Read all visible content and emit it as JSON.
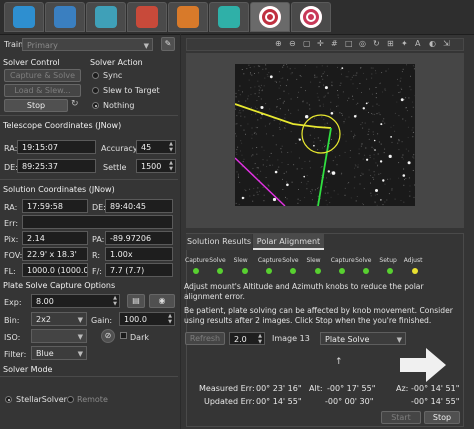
{
  "tabs": [
    {
      "name": "setup",
      "color": "#2e8fd0"
    },
    {
      "name": "capture",
      "color": "#3a7fc0"
    },
    {
      "name": "focus",
      "color": "#3fa0b8"
    },
    {
      "name": "camera",
      "color": "#c84a3a"
    },
    {
      "name": "analyze",
      "color": "#d87a2a"
    },
    {
      "name": "mount",
      "color": "#2fb0a8"
    },
    {
      "name": "target",
      "color": "#c03040",
      "active": true
    },
    {
      "name": "guide",
      "color": "#c83858"
    }
  ],
  "train": {
    "label": "Train:",
    "value": "Primary"
  },
  "solver_control": {
    "title": "Solver Control",
    "capture_solve": "Capture & Solve",
    "load_slew": "Load & Slew...",
    "stop": "Stop"
  },
  "solver_action": {
    "title": "Solver Action",
    "options": [
      {
        "label": "Sync",
        "selected": false
      },
      {
        "label": "Slew to Target",
        "selected": false
      },
      {
        "label": "Nothing",
        "selected": true
      }
    ]
  },
  "telescope": {
    "title": "Telescope Coordinates (JNow)",
    "ra_label": "RA:",
    "ra": "19:15:07",
    "de_label": "DE:",
    "de": "89:25:37",
    "accuracy_label": "Accuracy",
    "accuracy": "45",
    "settle_label": "Settle",
    "settle": "1500"
  },
  "solution": {
    "title": "Solution Coordinates (JNow)",
    "ra_label": "RA:",
    "ra": "17:59:58",
    "de_label": "DE:",
    "de": "89:40:45",
    "err_label": "Err:",
    "err": "",
    "pix_label": "Pix:",
    "pix": "2.14",
    "pa_label": "PA:",
    "pa": "-89.97206",
    "fov_label": "FOV:",
    "fov": "22.9' x 18.3'",
    "r_label": "R:",
    "r": "1.00x",
    "fl_label": "FL:",
    "fl": "1000.0 (1000.0)",
    "f_label": "F/:",
    "f": "7.7 (7.7)"
  },
  "capture": {
    "title": "Plate Solve Capture Options",
    "exp_label": "Exp:",
    "exp": "8.00",
    "bin_label": "Bin:",
    "bin": "2x2",
    "gain_label": "Gain:",
    "gain": "100.0",
    "iso_label": "ISO:",
    "iso": "",
    "dark_label": "Dark",
    "filter_label": "Filter:",
    "filter": "Blue"
  },
  "solver_mode": {
    "title": "Solver Mode",
    "options": [
      {
        "label": "StellarSolver",
        "selected": true
      },
      {
        "label": "Remote",
        "selected": false
      }
    ]
  },
  "image_toolbar": [
    "zoom-in",
    "zoom-out",
    "fit",
    "crosshair",
    "grid",
    "box",
    "center",
    "rotate",
    "eq-grid",
    "objects",
    "labels",
    "overlay",
    "select"
  ],
  "panel_tabs": {
    "solution_results": "Solution Results",
    "polar_alignment": "Polar Alignment"
  },
  "polar": {
    "steps": [
      {
        "label": "Capture",
        "state": "done"
      },
      {
        "label": "Solve",
        "state": "done"
      },
      {
        "label": "Slew",
        "state": "done"
      },
      {
        "label": "Capture",
        "state": "done"
      },
      {
        "label": "Solve",
        "state": "done"
      },
      {
        "label": "Slew",
        "state": "done"
      },
      {
        "label": "Capture",
        "state": "done"
      },
      {
        "label": "Solve",
        "state": "done"
      },
      {
        "label": "Setup",
        "state": "done"
      },
      {
        "label": "Adjust",
        "state": "active"
      }
    ],
    "done_color": "#58d030",
    "active_color": "#e8e030",
    "instruction": "Adjust mount's Altitude and Azimuth knobs to reduce the polar alignment error.",
    "warning": "Be patient, plate solving can be affected by knob movement. Consider using results after 2 images. Click Stop when the you're finished.",
    "refresh_label": "Refresh",
    "refresh_value": "2.0",
    "image_label": "Image 13",
    "method": "Plate Solve",
    "measured_label": "Measured Err:",
    "measured": "00° 23' 16\"",
    "updated_label": "Updated Err:",
    "updated": "00° 14' 55\"",
    "alt_label": "Alt:",
    "alt_measured": "-00° 17' 55\"",
    "alt_updated": "-00° 00' 30\"",
    "az_label": "Az:",
    "az_measured": "-00° 14' 51\"",
    "az_updated": "-00° 14' 55\"",
    "start": "Start",
    "stop": "Stop"
  }
}
